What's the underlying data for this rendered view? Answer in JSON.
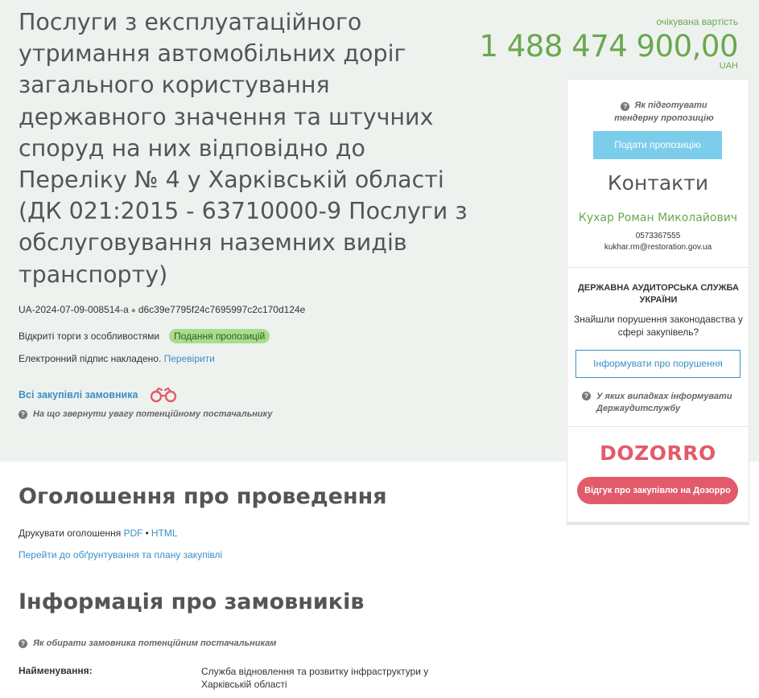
{
  "tender": {
    "title": "Послуги з експлуатаційного утримання автомобільних доріг загального користування державного значення та штучних споруд на них відповідно до Переліку № 4 у Харківській області (ДК 021:2015 - 63710000-9 Послуги з обслуговування наземних видів транспорту)",
    "id": "UA-2024-07-09-008514-a",
    "hash": "d6c39e7795f24c7695997c2c170d124e",
    "procedure_type": "Відкриті торги з особливостями",
    "status_badge": "Подання пропозицій",
    "esign_text": "Електронний підпис накладено.",
    "esign_link": "Перевірити",
    "all_purchases_link": "Всі закупівлі замовника",
    "attention_hint": "На що звернути увагу потенційному постачальнику"
  },
  "value": {
    "label": "очікувана вартість",
    "amount": "1 488 474 900,00",
    "currency": "UAH"
  },
  "sidebar": {
    "prepare_hint": "Як підготувати тендерну пропозицію",
    "submit_button": "Подати пропозицію",
    "contacts_title": "Контакти",
    "contact_name": "Кухар Роман Миколайович",
    "contact_phone": "0573367555",
    "contact_email": "kukhar.rm@restoration.gov.ua",
    "audit_title": "ДЕРЖАВНА АУДИТОРСЬКА СЛУЖБА УКРАЇНИ",
    "audit_text": "Знайшли порушення законодавства у сфері закупівель?",
    "report_button": "Інформувати про порушення",
    "report_hint": "У яких випадках інформувати Держаудитслужбу",
    "dozorro_logo": "DOZORRO",
    "dozorro_button": "Відгук про закупівлю на Дозорро"
  },
  "announcement": {
    "title": "Оголошення про проведення",
    "print_label": "Друкувати оголошення",
    "print_pdf": "PDF",
    "print_sep": "•",
    "print_html": "HTML",
    "justify_link": "Перейти до обґрунтування та плану закупівлі"
  },
  "customers": {
    "title": "Інформація про замовників",
    "hint": "Як обирати замовника потенційним постачальникам",
    "name_label": "Найменування:",
    "name_value": "Служба відновлення та розвитку інфраструктури у Харківській області"
  },
  "colors": {
    "accent_green": "#6aa84f",
    "link_blue": "#3a8fc7",
    "submit_blue": "#7ccdeb",
    "dozorro_red": "#e25b6b",
    "badge_green": "#a8dd8d"
  }
}
